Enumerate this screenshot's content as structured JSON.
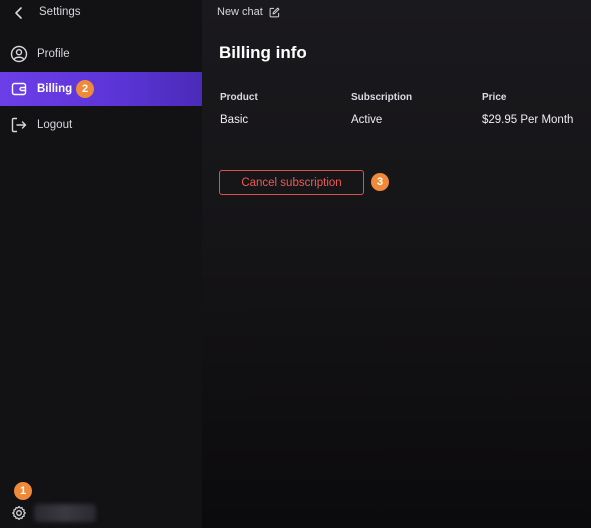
{
  "sidebar": {
    "title": "Settings",
    "items": [
      {
        "label": "Profile",
        "icon": "user-circle-icon"
      },
      {
        "label": "Billing",
        "icon": "wallet-icon",
        "active": true
      },
      {
        "label": "Logout",
        "icon": "logout-icon"
      }
    ],
    "footer": {
      "icon": "gear-icon"
    }
  },
  "badges": {
    "one": "1",
    "two": "2",
    "three": "3"
  },
  "main": {
    "new_chat_label": "New chat",
    "title": "Billing info",
    "columns": [
      "Product",
      "Subscription",
      "Price"
    ],
    "row": [
      "Basic",
      "Active",
      "$29.95 Per Month"
    ],
    "cancel_label": "Cancel subscription"
  },
  "colors": {
    "accent": "#5b34d6",
    "badge": "#ef8a3a",
    "danger": "#ee5a55"
  }
}
